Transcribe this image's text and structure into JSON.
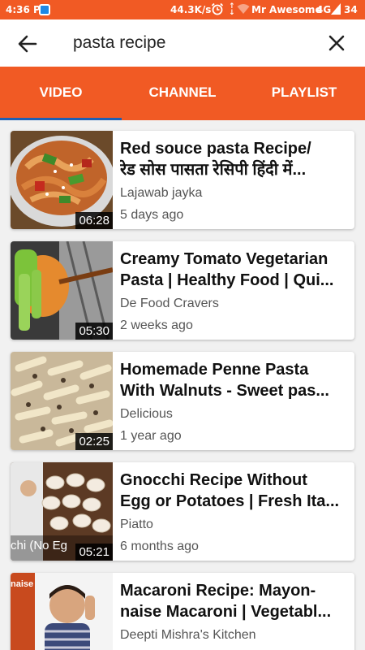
{
  "status_bar": {
    "time": "4:36 PM",
    "speed": "44.3K/s",
    "carrier": "Mr Awesome",
    "network": "4G",
    "battery": "34",
    "icons": [
      "app-notification-icon",
      "alarm-icon",
      "data-arrows-icon",
      "wifi-icon",
      "signal-icon",
      "battery-icon"
    ]
  },
  "search": {
    "query": "pasta recipe",
    "icons": [
      "back-arrow-icon",
      "close-icon"
    ]
  },
  "tabs": [
    {
      "label": "VIDEO",
      "selected": true
    },
    {
      "label": "CHANNEL",
      "selected": false
    },
    {
      "label": "PLAYLIST",
      "selected": false
    }
  ],
  "colors": {
    "accent": "#f15a24",
    "tab_indicator": "#1e5fb4"
  },
  "videos": [
    {
      "title_line1": "Red souce pasta Recipe/",
      "title_line2": "रेड सोस पासता रेसिपी हिंदी में...",
      "channel": "Lajawab jayka",
      "age": "5 days ago",
      "duration": "06:28"
    },
    {
      "title_line1": "Creamy Tomato Vegetarian",
      "title_line2": "Pasta | Healthy Food | Qui...",
      "channel": "De Food Cravers",
      "age": "2 weeks ago",
      "duration": "05:30"
    },
    {
      "title_line1": "Homemade Penne Pasta",
      "title_line2": "With Walnuts - Sweet pas...",
      "channel": "Delicious",
      "age": "1 year ago",
      "duration": "02:25"
    },
    {
      "title_line1": "Gnocchi Recipe Without",
      "title_line2": "Egg or Potatoes | Fresh Ita...",
      "channel": "Piatto",
      "age": "6 months ago",
      "duration": "05:21",
      "thumb_text": "chi (No Eg"
    },
    {
      "title_line1": "Macaroni Recipe: Mayon-",
      "title_line2": "naise Macaroni | Vegetabl...",
      "channel": "Deepti Mishra's Kitchen",
      "age": "",
      "duration": "",
      "thumb_text": "naise"
    }
  ]
}
